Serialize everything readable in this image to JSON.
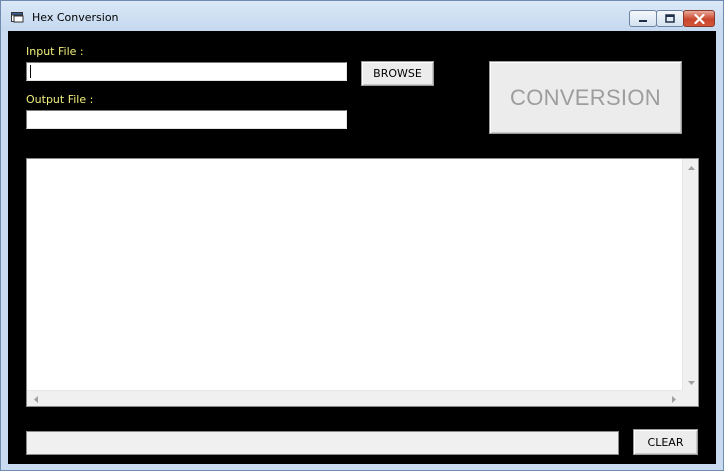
{
  "window": {
    "title": "Hex Conversion",
    "minimize_icon": "minimize-icon",
    "maximize_icon": "maximize-icon",
    "close_icon": "close-icon"
  },
  "form": {
    "input_label": "Input File :",
    "input_value": "",
    "output_label": "Output File :",
    "output_value": "",
    "browse_label": "BROWSE",
    "conversion_label": "CONVERSION",
    "clear_label": "CLEAR"
  },
  "log": {
    "content": ""
  },
  "status": {
    "text": ""
  },
  "colors": {
    "client_background": "#000000",
    "label_color": "#f2f07a",
    "disabled_text": "#9d9d9d"
  }
}
